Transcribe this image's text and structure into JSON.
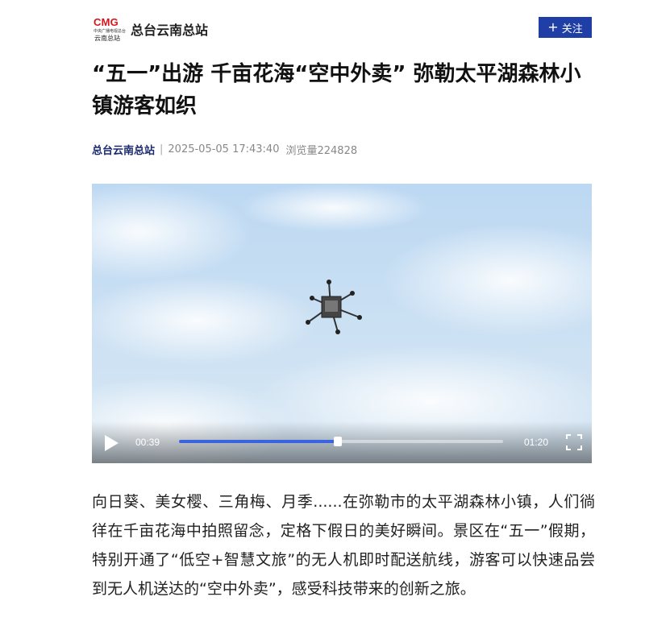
{
  "header": {
    "logo_text": "CMG",
    "logo_sub": "中央广播电视总台",
    "logo_sub2": "云南总站",
    "channel_name": "总台云南总站",
    "follow_label": "关注",
    "follow_icon": "plus-icon"
  },
  "article": {
    "title": "“五一”出游 千亩花海“空中外卖” 弥勒太平湖森林小镇游客如织",
    "source": "总台云南总站",
    "separator": "|",
    "datetime": "2025-05-05 17:43:40",
    "views": "浏览量224828",
    "body": "向日葵、美女樱、三角梅、月季......在弥勒市的太平湖森林小镇，人们徜徉在千亩花海中拍照留念，定格下假日的美好瞬间。景区在“五一”假期，特别开通了“低空+智慧文旅”的无人机即时配送航线，游客可以快速品尝到无人机送达的“空中外卖”，感受科技带来的创新之旅。"
  },
  "video": {
    "current_time": "00:39",
    "total_time": "01:20",
    "progress_fraction": 0.49,
    "icons": [
      "play-icon",
      "fullscreen-icon"
    ],
    "accent_color": "#3a63e0"
  },
  "colors": {
    "follow_button": "#1f3fa6",
    "source_text": "#1a2a6c",
    "logo_red": "#d7141a"
  }
}
